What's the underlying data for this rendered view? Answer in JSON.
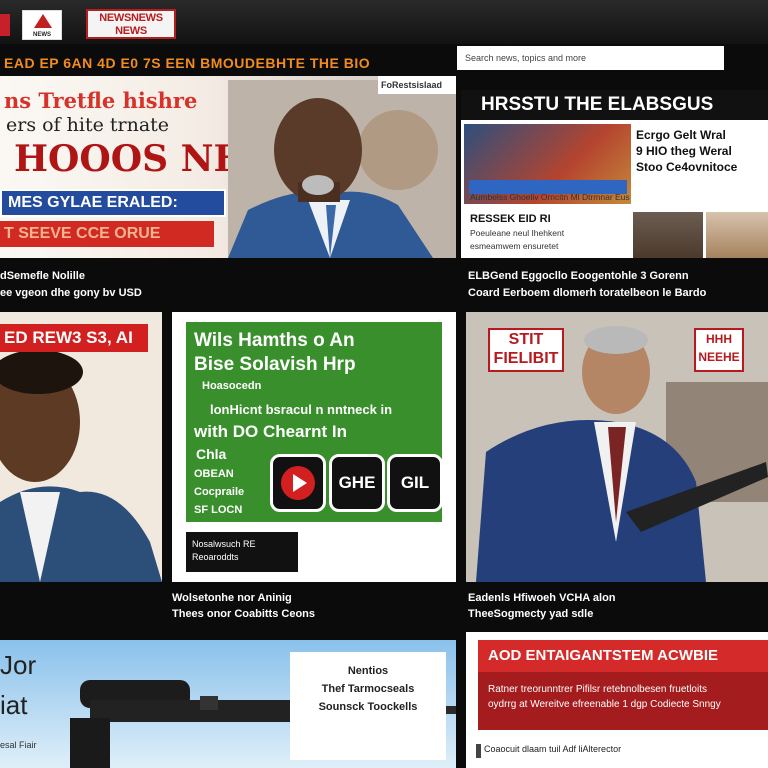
{
  "header": {
    "logo_small_text": "NEWS",
    "logo_main": "NEWSNEWS\nNEWS",
    "ticker": "EAD EP 6AN 4D E0 7S EEN BMOUDEBHTE THE BIO",
    "search_placeholder": "Search news, topics and more"
  },
  "hero": {
    "tag": "FoRestsislaad",
    "headline_red": "ns Tretfle hishre",
    "headline_dark": "ers of hite trnate",
    "headline_big": "HOOOS NH",
    "band_blue": "MES GYLAE ERALED:",
    "band_red": "T SEEVE CCE ORUE",
    "caption_1": "dSemefle Nolille",
    "caption_2": "ee vgeon dhe gony bv USD"
  },
  "right_box": {
    "header": "HRSSTU THE ELABSGUS",
    "line1": "Ecrgo Gelt Wral",
    "line2": "9 HIO theg Weral",
    "line3": "Stoo Ce4ovnitoce",
    "small_row": "Aumbelss Ghoeliv Orncitn Ml Dtrmnar Eus",
    "teaser_title": "RESSEK EID RI",
    "teaser_1": "Poeuleane neul Ihehkent",
    "teaser_2": "esmeamwem ensuretet",
    "caption_1": "ELBGend Eggocllo Eoogentohle 3 Gorenn",
    "caption_2": "Coard Eerboem dlomerh toratelbeon le Bardo"
  },
  "row2": {
    "left_tag": "ED REW3 S3, AI",
    "green_l1": "Wils Hamths o An",
    "green_l2": "Bise Solavish Hrp",
    "green_l3": "Hoasocedn",
    "green_l4": "lonHicnt bsracul n nntneck in",
    "green_l5": "with DO Chearnt In",
    "green_l6": "Chla",
    "green_l7": "OBEAN",
    "green_l8": "Cocpraile",
    "green_l9": "SF LOCN",
    "icon_labels": [
      "",
      "GHE",
      "GIL"
    ],
    "black_btn_1": "Nosalwsuch RE",
    "black_btn_2": "Reoaroddts",
    "mid_caption_1": "Wolsetonhe nor Aninig",
    "mid_caption_2": "Thees onor Coabitts Ceons",
    "badge_left": "STIT\nFIELIBIT",
    "badge_right": "HHH\nNEEHE",
    "right_caption_1": "Eadenls Hfiwoeh VCHA alon",
    "right_caption_2": "TheeSogmecty yad sdle"
  },
  "row3": {
    "left_big_1": "Jor",
    "left_big_2": "iat",
    "left_small": "esal Fiair",
    "box_1": "Nentios",
    "box_2": "Thef Tarmocseals",
    "box_3": "Sounsck Toockells",
    "right_bar": "AOD ENTAIGANTSTEM ACWBIE",
    "right_dark_1": "Ratner treorunntrer Pifilsr retebnolbesen fruetloits",
    "right_dark_2": "oydrrg at Wereitve efreenable 1 dgp Codiecte Snngy",
    "right_foot": "Coaocuit dlaam tuil Adf liAlterector"
  },
  "colors": {
    "accent_red": "#d21f1f",
    "accent_blue": "#234c9e",
    "accent_green": "#3a8f2d",
    "ticker_orange": "#f28c1e"
  }
}
